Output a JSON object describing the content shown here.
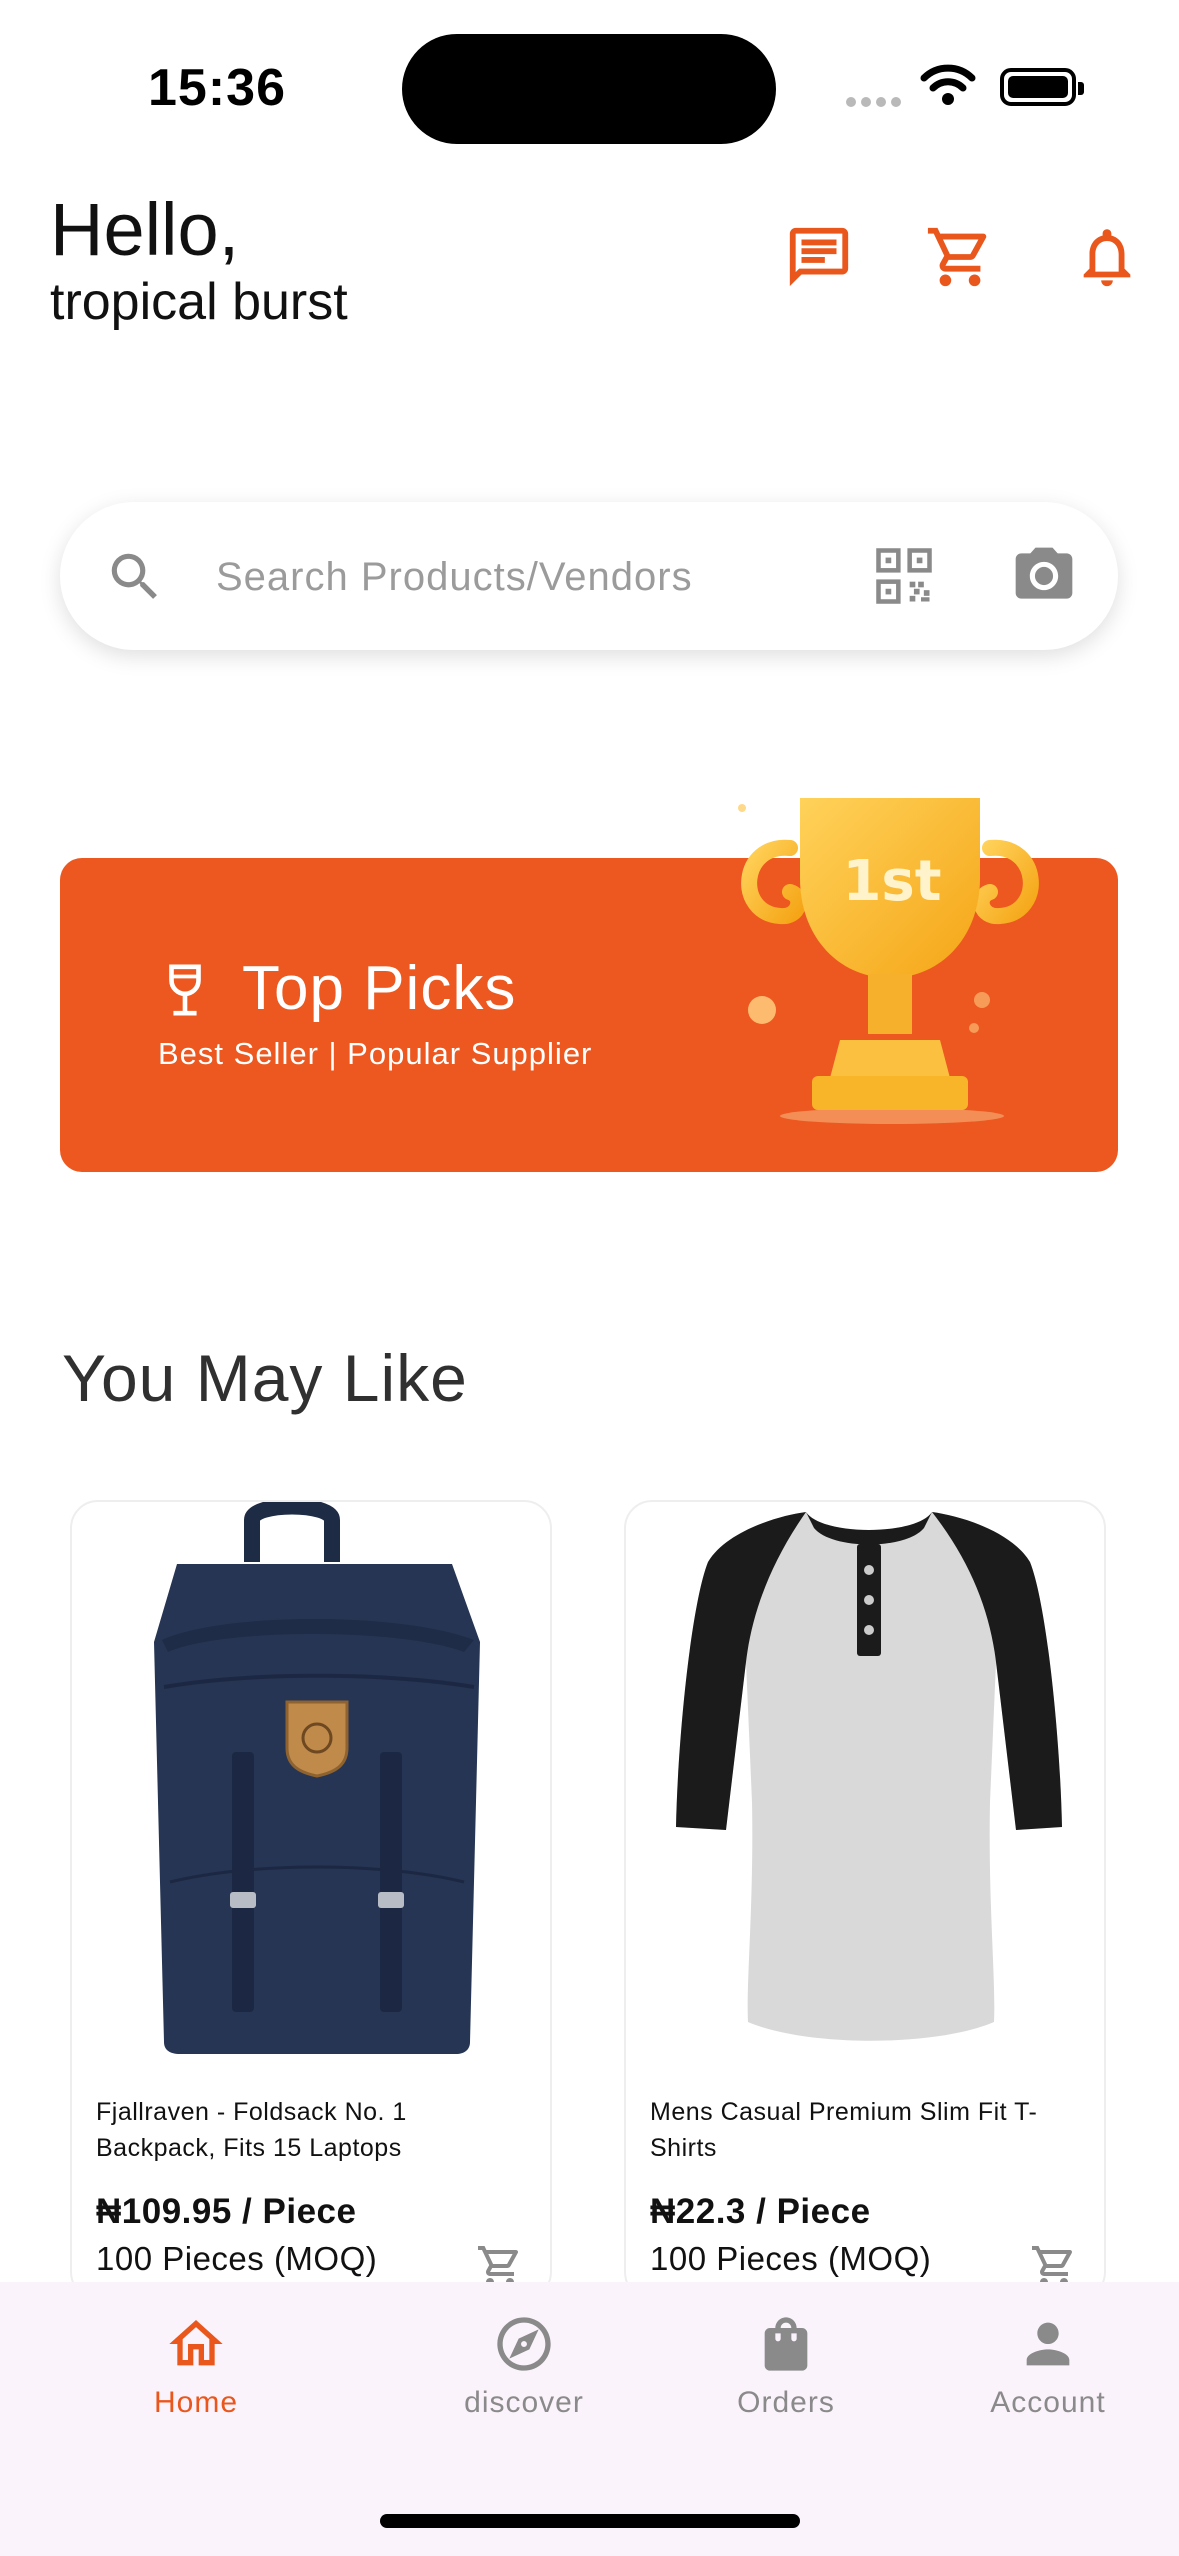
{
  "status_bar": {
    "time": "15:36"
  },
  "header": {
    "greeting": "Hello,",
    "username": "tropical burst",
    "icons": [
      "chat-icon",
      "cart-icon",
      "bell-icon"
    ]
  },
  "search": {
    "placeholder": "Search Products/Vendors",
    "value": ""
  },
  "banner": {
    "title": "Top Picks",
    "subtitle": "Best Seller | Popular Supplier",
    "trophy_text": "1st"
  },
  "section": {
    "title": "You May Like"
  },
  "products": [
    {
      "name": "Fjallraven - Foldsack No. 1 Backpack, Fits 15 Laptops",
      "price": "₦109.95 / Piece",
      "moq": "100 Pieces (MOQ)"
    },
    {
      "name": "Mens Casual Premium Slim Fit T-Shirts",
      "price": "₦22.3 / Piece",
      "moq": "100 Pieces (MOQ)"
    }
  ],
  "nav": {
    "items": [
      {
        "label": "Home",
        "icon": "home-icon",
        "active": true
      },
      {
        "label": "discover",
        "icon": "compass-icon",
        "active": false
      },
      {
        "label": "Orders",
        "icon": "bag-icon",
        "active": false
      },
      {
        "label": "Account",
        "icon": "person-icon",
        "active": false
      }
    ]
  },
  "colors": {
    "accent": "#ec581f",
    "nav_bg": "#fbf3fb",
    "muted": "#8a8a8a"
  }
}
